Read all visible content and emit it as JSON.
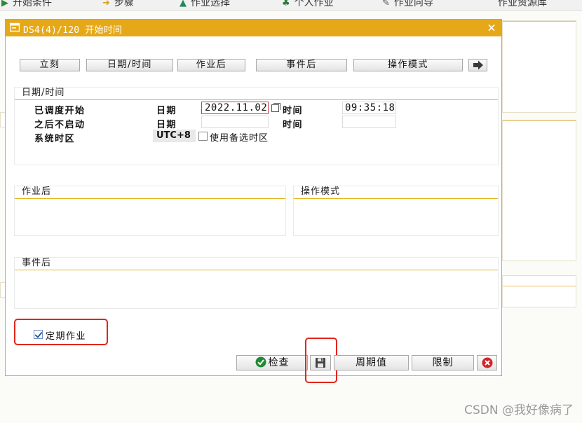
{
  "background": {
    "toolbar_items": [
      {
        "icon": "start-condition-icon",
        "label": "开始条件"
      },
      {
        "icon": "step-icon",
        "label": "步骤"
      },
      {
        "icon": "job-selection-icon",
        "label": "作业选择"
      },
      {
        "icon": "own-job-icon",
        "label": "个人作业"
      },
      {
        "icon": "job-wizard-icon",
        "label": "作业向导"
      },
      {
        "icon": "",
        "label": "作业资源库"
      }
    ],
    "watermark": "CSDN @我好像病了"
  },
  "dialog": {
    "title": "DS4(4)/120 开始时间",
    "close_symbol": "×",
    "title_icon": "window-icon",
    "top_buttons": {
      "immediate": "立刻",
      "date_time": "日期/时间",
      "after_job": "作业后",
      "after_event": "事件后",
      "op_mode": "操作模式",
      "more_icon": "arrow-right-icon"
    },
    "date_time_group": {
      "title": "日期/时间",
      "scheduled_start_label": "已调度开始",
      "no_start_after_label": "之后不启动",
      "system_timezone_label": "系统时区",
      "date_label": "日期",
      "time_label": "时间",
      "start_date": "2022.11.02",
      "start_time": "09:35:18",
      "no_start_date": "",
      "no_start_time": "",
      "timezone_value": "UTC+8",
      "use_alt_timezone_label": "使用备选时区",
      "use_alt_timezone_checked": false
    },
    "after_job_group": {
      "title": "作业后"
    },
    "op_mode_group": {
      "title": "操作模式"
    },
    "after_event_group": {
      "title": "事件后"
    },
    "periodic_job": {
      "label": "定期作业",
      "checked": true
    },
    "bottom_buttons": {
      "check": "检查",
      "check_icon": "check-circle-icon",
      "save_icon": "save-icon",
      "period_values": "周期值",
      "restrictions": "限制",
      "cancel_icon": "cancel-icon"
    },
    "colors": {
      "title_bar": "#e5a818",
      "highlight": "#e0261b",
      "accent_line": "#e6b422"
    }
  }
}
